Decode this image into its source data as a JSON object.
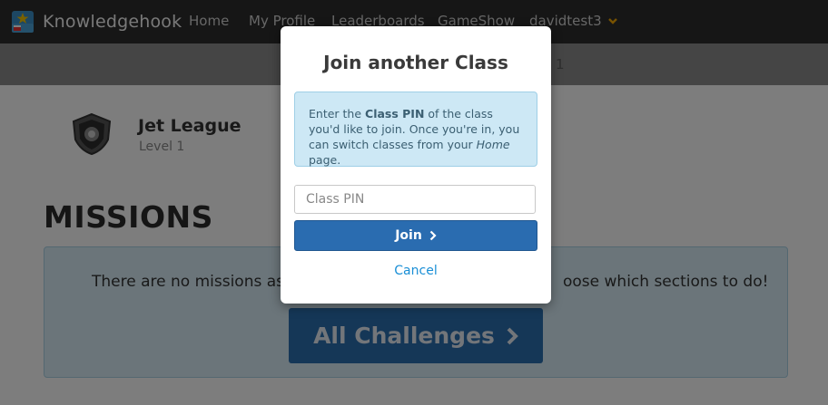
{
  "navbar": {
    "brand": "Knowledgehook",
    "links": [
      "Home",
      "My Profile",
      "Leaderboards",
      "GameShow",
      "davidtest3"
    ]
  },
  "subbar": {
    "text_right": "1"
  },
  "profile": {
    "name": "Jet League",
    "level": "Level 1"
  },
  "missions": {
    "title": "MISSIONS",
    "message_left": "There are no missions assi",
    "message_right": "oose which sections to do!",
    "all_challenges": "All Challenges"
  },
  "modal": {
    "title": "Join another Class",
    "info_pre": "Enter the ",
    "info_bold": "Class PIN",
    "info_mid": " of the class you'd like to join. Once you're in, you can switch classes from your ",
    "info_italic": "Home",
    "info_post": " page.",
    "pin_placeholder": "Class PIN",
    "join_label": "Join",
    "cancel_label": "Cancel"
  },
  "colors": {
    "accent": "#2a6cb0",
    "link": "#1a8fd6",
    "info_bg": "#cde8f5",
    "dropdown_chevron": "#f0a500"
  },
  "icons": [
    "knowledgehook-logo-icon",
    "chevron-down-icon",
    "shield-badge-icon",
    "chevron-right-icon"
  ]
}
